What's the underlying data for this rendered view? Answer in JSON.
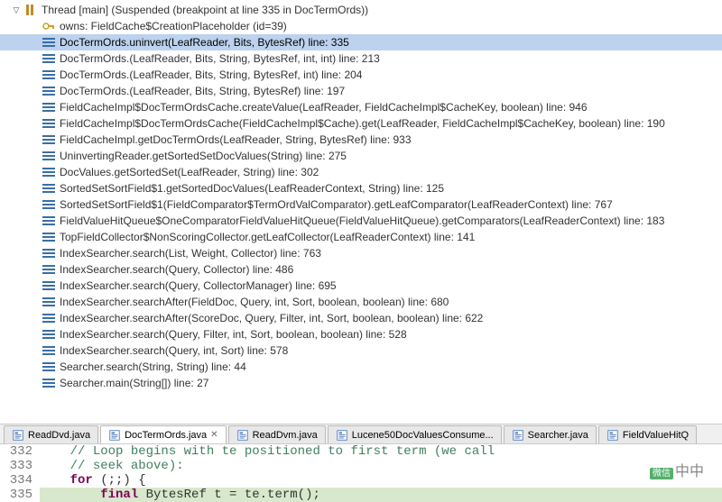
{
  "thread": {
    "label": "Thread [main] (Suspended (breakpoint at line 335 in DocTermOrds))",
    "owns": "owns: FieldCache$CreationPlaceholder  (id=39)"
  },
  "frames": [
    {
      "label": "DocTermOrds.uninvert(LeafReader, Bits, BytesRef) line: 335",
      "selected": true
    },
    {
      "label": "DocTermOrds.<init>(LeafReader, Bits, String, BytesRef, int, int) line: 213"
    },
    {
      "label": "DocTermOrds.<init>(LeafReader, Bits, String, BytesRef, int) line: 204"
    },
    {
      "label": "DocTermOrds.<init>(LeafReader, Bits, String, BytesRef) line: 197"
    },
    {
      "label": "FieldCacheImpl$DocTermOrdsCache.createValue(LeafReader, FieldCacheImpl$CacheKey, boolean) line: 946"
    },
    {
      "label": "FieldCacheImpl$DocTermOrdsCache(FieldCacheImpl$Cache).get(LeafReader, FieldCacheImpl$CacheKey, boolean) line: 190"
    },
    {
      "label": "FieldCacheImpl.getDocTermOrds(LeafReader, String, BytesRef) line: 933"
    },
    {
      "label": "UninvertingReader.getSortedSetDocValues(String) line: 275"
    },
    {
      "label": "DocValues.getSortedSet(LeafReader, String) line: 302"
    },
    {
      "label": "SortedSetSortField$1.getSortedDocValues(LeafReaderContext, String) line: 125"
    },
    {
      "label": "SortedSetSortField$1(FieldComparator$TermOrdValComparator).getLeafComparator(LeafReaderContext) line: 767"
    },
    {
      "label": "FieldValueHitQueue$OneComparatorFieldValueHitQueue<T>(FieldValueHitQueue<T>).getComparators(LeafReaderContext) line: 183"
    },
    {
      "label": "TopFieldCollector$NonScoringCollector.getLeafCollector(LeafReaderContext) line: 141"
    },
    {
      "label": "IndexSearcher.search(List<LeafReaderContext>, Weight, Collector) line: 763"
    },
    {
      "label": "IndexSearcher.search(Query, Collector) line: 486"
    },
    {
      "label": "IndexSearcher.search(Query, CollectorManager<C,T>) line: 695"
    },
    {
      "label": "IndexSearcher.searchAfter(FieldDoc, Query, int, Sort, boolean, boolean) line: 680"
    },
    {
      "label": "IndexSearcher.searchAfter(ScoreDoc, Query, Filter, int, Sort, boolean, boolean) line: 622"
    },
    {
      "label": "IndexSearcher.search(Query, Filter, int, Sort, boolean, boolean) line: 528"
    },
    {
      "label": "IndexSearcher.search(Query, int, Sort) line: 578"
    },
    {
      "label": "Searcher.search(String, String) line: 44"
    },
    {
      "label": "Searcher.main(String[]) line: 27"
    }
  ],
  "tabs": [
    {
      "label": "ReadDvd.java"
    },
    {
      "label": "DocTermOrds.java",
      "active": true,
      "closable": true
    },
    {
      "label": "ReadDvm.java"
    },
    {
      "label": "Lucene50DocValuesConsume..."
    },
    {
      "label": "Searcher.java"
    },
    {
      "label": "FieldValueHitQ"
    }
  ],
  "code": {
    "lines": [
      {
        "n": "332",
        "comment": "// Loop begins with te positioned to first term (we call"
      },
      {
        "n": "333",
        "comment": "// seek above):"
      },
      {
        "n": "334",
        "plain_pre": "",
        "kw": "for",
        "plain_post": " (;;) {"
      },
      {
        "n": "335",
        "hl": true,
        "plain_pre": "    ",
        "kw": "final",
        "plain_mid": " BytesRef t = te.term();"
      }
    ]
  },
  "watermark": "中中"
}
